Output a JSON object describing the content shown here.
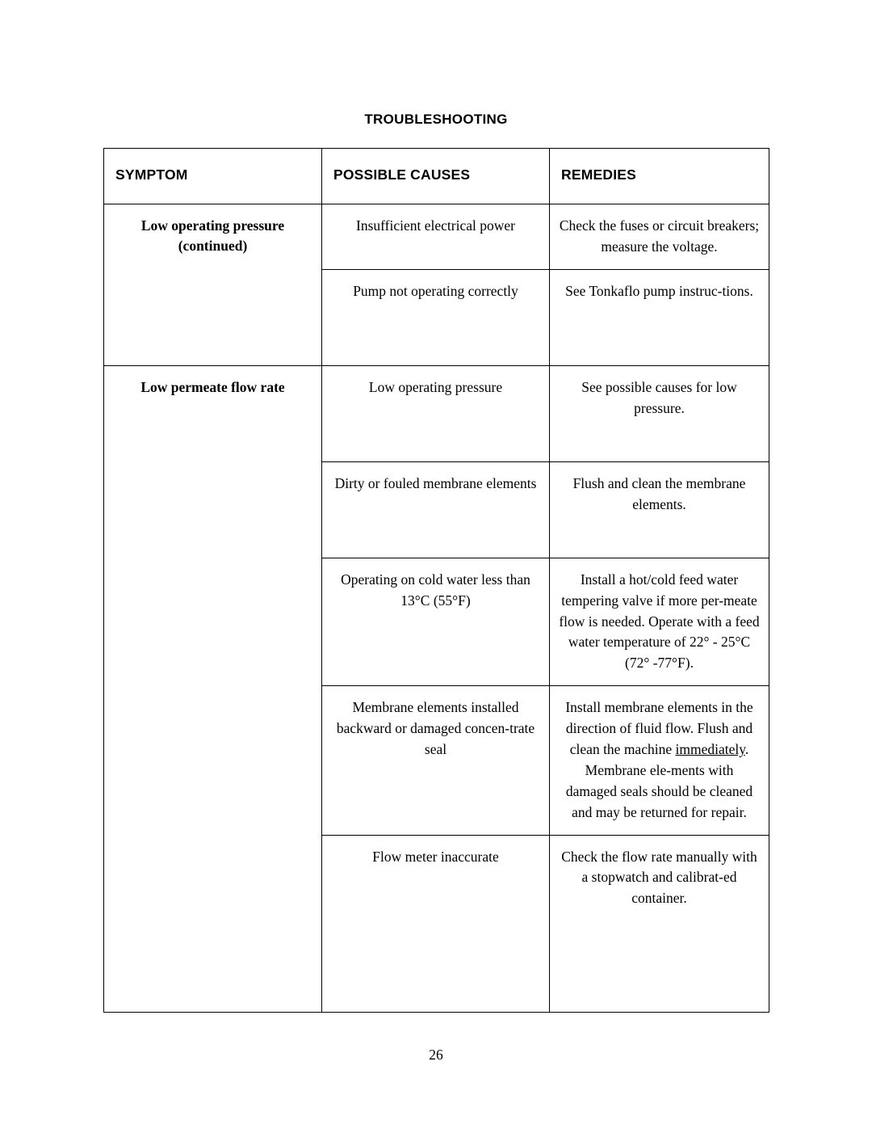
{
  "document": {
    "title": "TROUBLESHOOTING",
    "page_number": "26"
  },
  "table": {
    "headers": {
      "symptom": "SYMPTOM",
      "possible_causes": "POSSIBLE CAUSES",
      "remedies": "REMEDIES"
    },
    "rows": [
      {
        "symptom": "Low operating pressure (continued)",
        "cause": "Insufficient electrical power",
        "remedy": "Check the fuses or circuit breakers; measure the voltage."
      },
      {
        "symptom": "",
        "cause": "Pump not operating correctly",
        "remedy": "See Tonkaflo pump instruc-tions."
      },
      {
        "symptom": "Low permeate flow rate",
        "cause": "Low operating pressure",
        "remedy": "See possible causes for low pressure."
      },
      {
        "symptom": "",
        "cause": "Dirty or fouled membrane elements",
        "remedy": "Flush and clean the membrane elements."
      },
      {
        "symptom": "",
        "cause": "Operating on cold water less than 13°C (55°F)",
        "remedy_part1": "Install a hot/cold feed water tempering valve if more per-meate flow is needed. Operate with a feed water temperature of 22° - 25°C (72° -77°F)."
      },
      {
        "symptom": "",
        "cause": "Membrane elements installed backward or damaged concen-trate seal",
        "remedy_a": "Install membrane elements in the direction of fluid flow. Flush and clean the machine",
        "remedy_underlined": "immediately",
        "remedy_b": ".  Membrane ele-ments with damaged seals should be cleaned and may be returned for repair."
      },
      {
        "symptom": "",
        "cause": "Flow meter inaccurate",
        "remedy": "Check the flow rate manually with a stopwatch and calibrat-ed container."
      }
    ]
  }
}
